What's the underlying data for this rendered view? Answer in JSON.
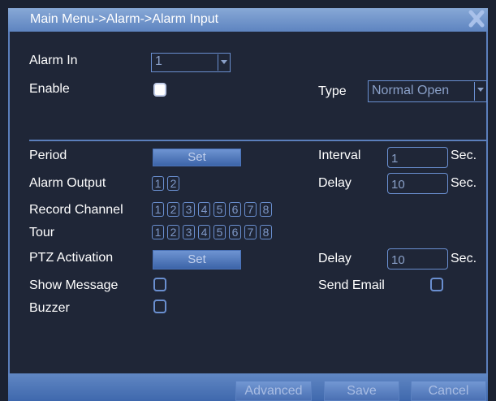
{
  "window": {
    "title": "Main Menu->Alarm->Alarm Input"
  },
  "form": {
    "alarm_in": {
      "label": "Alarm In",
      "value": "1"
    },
    "enable": {
      "label": "Enable",
      "checked": true
    },
    "type": {
      "label": "Type",
      "value": "Normal Open"
    },
    "period": {
      "label": "Period",
      "button": "Set"
    },
    "interval": {
      "label": "Interval",
      "value": "1",
      "unit": "Sec."
    },
    "alarm_output": {
      "label": "Alarm Output",
      "channels": [
        "1",
        "2"
      ]
    },
    "delay1": {
      "label": "Delay",
      "value": "10",
      "unit": "Sec."
    },
    "record_channel": {
      "label": "Record Channel",
      "channels": [
        "1",
        "2",
        "3",
        "4",
        "5",
        "6",
        "7",
        "8"
      ]
    },
    "tour": {
      "label": "Tour",
      "channels": [
        "1",
        "2",
        "3",
        "4",
        "5",
        "6",
        "7",
        "8"
      ]
    },
    "ptz_activation": {
      "label": "PTZ Activation",
      "button": "Set"
    },
    "delay2": {
      "label": "Delay",
      "value": "10",
      "unit": "Sec."
    },
    "show_message": {
      "label": "Show Message",
      "checked": false
    },
    "send_email": {
      "label": "Send Email",
      "checked": false
    },
    "buzzer": {
      "label": "Buzzer",
      "checked": false
    }
  },
  "footer": {
    "advanced": "Advanced",
    "save": "Save",
    "cancel": "Cancel"
  },
  "icons": {
    "close": "close-icon",
    "dropdown": "chevron-down-icon"
  },
  "colors": {
    "title_bar": "#6f93cb",
    "background": "#1f2637",
    "border_blue": "#6a8fd0",
    "text": "#ffffff"
  }
}
